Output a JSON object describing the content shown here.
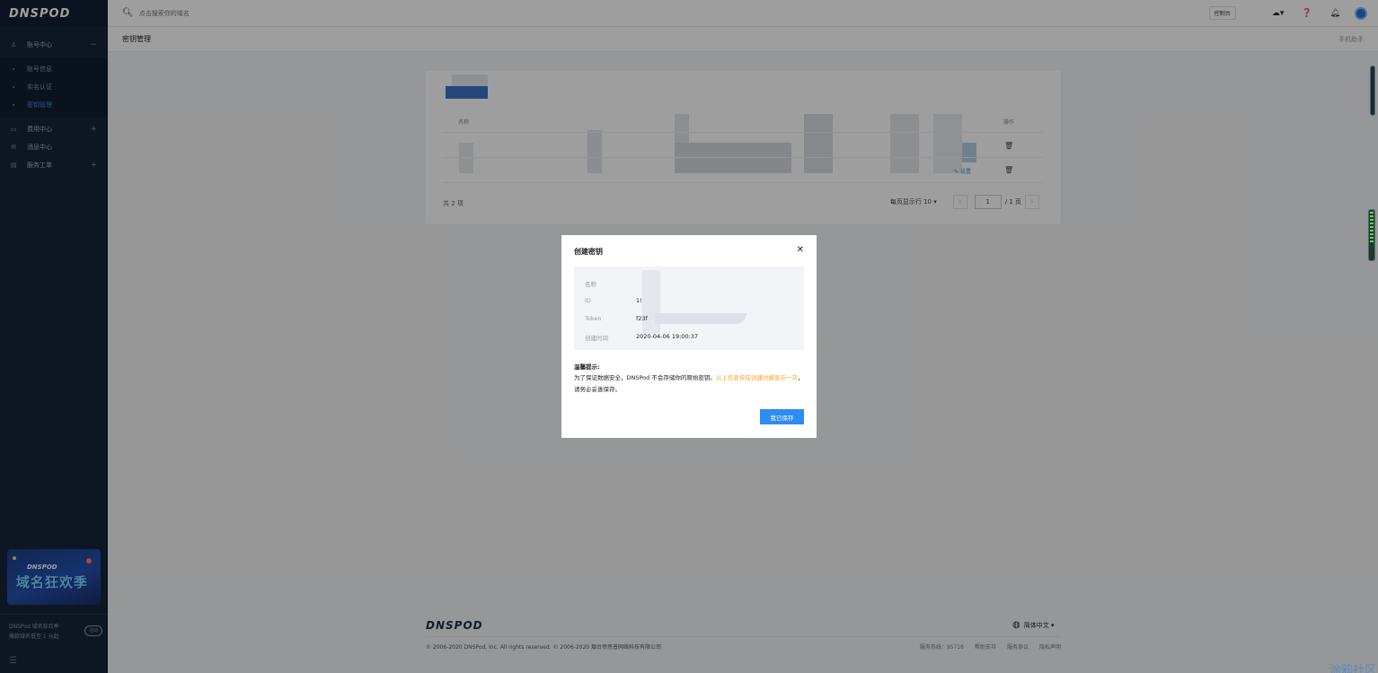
{
  "app": {
    "logo": "DNSPOD"
  },
  "sidebar": {
    "groups": [
      {
        "label": "账号中心",
        "toggle": "−"
      },
      {
        "label": "费用中心",
        "toggle": "+"
      },
      {
        "label": "消息中心",
        "toggle": ""
      },
      {
        "label": "服务工单",
        "toggle": "+"
      }
    ],
    "sub_items": [
      {
        "label": "账号信息"
      },
      {
        "label": "实名认证"
      },
      {
        "label": "密钥管理"
      }
    ],
    "promo": {
      "brand": "DNSPOD",
      "title": "域名狂欢季"
    },
    "footer": {
      "line1": "DNSPod 域名狂欢季",
      "line2": "爆款域名低至 1 元起",
      "badge": "活动"
    }
  },
  "topbar": {
    "search_placeholder": "点击搜索你的域名",
    "console_label": "控制台"
  },
  "breadcrumb": {
    "title": "密钥管理",
    "right": "手机助手"
  },
  "table": {
    "headers": {
      "name": "名称",
      "action": "操作"
    },
    "set_link": "设置",
    "total": "共 2 项",
    "page_size_label": "每页显示行 10",
    "page_current": "1",
    "page_total": "/ 1 页"
  },
  "footer": {
    "logo": "DNSPOD",
    "language": "简体中文",
    "copyright": "© 2006-2020 DNSPod, Inc. All rights reserved. © 2006-2020 烟台帝思普网络科技有限公司",
    "links": [
      "服务热线：95716",
      "帮助支持",
      "服务协议",
      "隐私声明"
    ]
  },
  "modal": {
    "title": "创建密钥",
    "fields": [
      {
        "label": "名称",
        "value": ""
      },
      {
        "label": "ID",
        "value": "1!"
      },
      {
        "label": "Token",
        "value": "f23f"
      },
      {
        "label": "创建时间",
        "value": "2020-04-06 19:00:37"
      }
    ],
    "tip_title": "温馨提示:",
    "tip_text": "为了保证数据安全，DNSPod 不会存储你的原始密钥。",
    "tip_warn": "以上信息仅在创建时被显示一次",
    "tip_end": "，请务必妥善保存。",
    "confirm": "我已保存"
  },
  "watermark": "涂鸦社区"
}
